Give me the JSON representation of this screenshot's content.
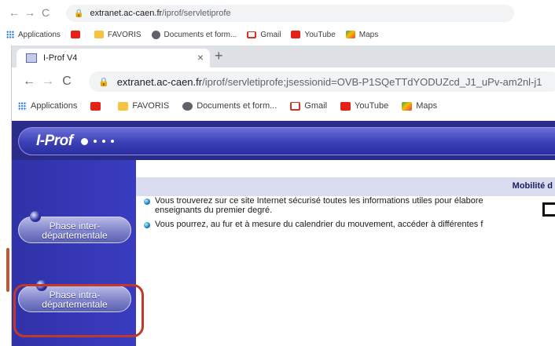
{
  "back_browser": {
    "url_host": "extranet.ac-caen.fr",
    "url_path": "/iprof/servletiprofe",
    "nav": {
      "back": "←",
      "forward": "→",
      "reload": "C"
    }
  },
  "front_browser": {
    "tab_title": "I-Prof V4",
    "tab_close": "×",
    "new_tab": "+",
    "url_host": "extranet.ac-caen.fr",
    "url_path": "/iprof/servletiprofe;jsessionid=OVB-P1SQeTTdYODUZcd_J1_uPv-am2nl-j1",
    "nav": {
      "back": "←",
      "forward": "→",
      "reload": "C"
    }
  },
  "bookmarks": [
    {
      "label": "Applications",
      "icon": "apps-grid-icon"
    },
    {
      "label": "",
      "icon": "youtube-icon"
    },
    {
      "label": "FAVORIS",
      "icon": "folder-icon"
    },
    {
      "label": "Documents et form...",
      "icon": "globe-icon"
    },
    {
      "label": "Gmail",
      "icon": "gmail-icon"
    },
    {
      "label": "YouTube",
      "icon": "youtube-icon"
    },
    {
      "label": "Maps",
      "icon": "maps-icon"
    }
  ],
  "app": {
    "logo": "I-Prof",
    "section_title": "Mobilité d",
    "paragraphs": [
      {
        "line1": "Vous trouverez sur ce site Internet sécurisé toutes les informations utiles pour élabore",
        "line2": "enseignants du premier degré."
      },
      {
        "line1": "Vous pourrez, au fur et à mesure du calendrier du mouvement, accéder à différentes f",
        "line2": ""
      }
    ],
    "buttons": {
      "inter_line1": "Phase inter-",
      "inter_line2": "départementale",
      "intra_line1": "Phase intra-",
      "intra_line2": "départementale"
    }
  },
  "colors": {
    "header_blue": "#2b2b8a",
    "sidebar_blue": "#3a3cc0",
    "band": "#dadcf0",
    "highlight_red": "#c0392b"
  }
}
